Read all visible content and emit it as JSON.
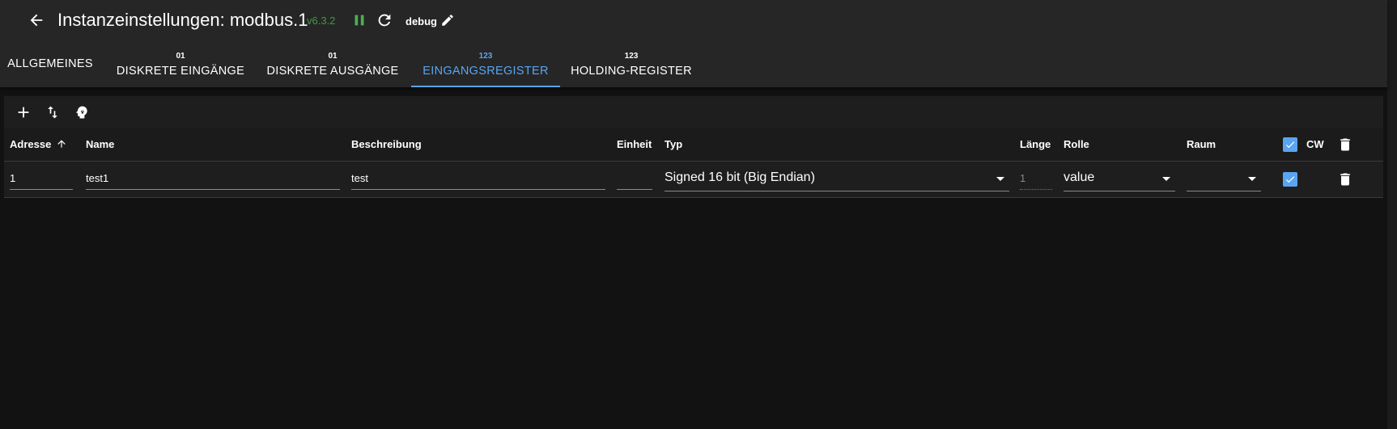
{
  "header": {
    "title": "Instanzeinstellungen: modbus.1",
    "version": "v6.3.2",
    "loglevel": "debug",
    "icons": {
      "back": "arrow-left-icon",
      "pause": "pause-icon",
      "reload": "reload-icon",
      "edit": "pencil-icon"
    }
  },
  "tabs": [
    {
      "count": "",
      "label": "ALLGEMEINES",
      "active": false
    },
    {
      "count": "01",
      "label": "DISKRETE EINGÄNGE",
      "active": false
    },
    {
      "count": "01",
      "label": "DISKRETE AUSGÄNGE",
      "active": false
    },
    {
      "count": "123",
      "label": "EINGANGSREGISTER",
      "active": true
    },
    {
      "count": "123",
      "label": "HOLDING-REGISTER",
      "active": false
    }
  ],
  "toolbar": {
    "icons": [
      "plus-icon",
      "swap-vert-icon",
      "head-icon"
    ]
  },
  "table": {
    "columns": {
      "address": "Adresse",
      "name": "Name",
      "description": "Beschreibung",
      "unit": "Einheit",
      "type": "Typ",
      "length": "Länge",
      "role": "Rolle",
      "room": "Raum",
      "cw": "CW"
    },
    "sort_indicator": "arrow-up-icon",
    "rows": [
      {
        "address": "1",
        "name": "test1",
        "description": "test",
        "unit": "",
        "type": "Signed 16 bit (Big Endian)",
        "length": "1",
        "role": "value",
        "room": "",
        "cw": true
      }
    ]
  },
  "colors": {
    "accent": "#5aa5f2",
    "version": "#3e9a47",
    "pause": "#4caf50",
    "background": "#121212",
    "appbar": "#262626"
  }
}
